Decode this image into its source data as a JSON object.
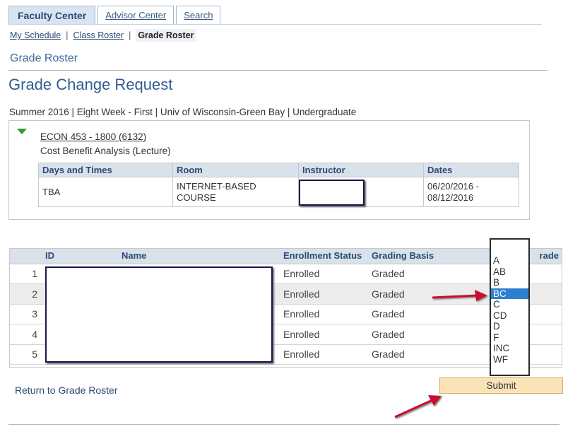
{
  "tabs": [
    {
      "label": "Faculty Center",
      "active": true
    },
    {
      "label": "Advisor Center",
      "active": false
    },
    {
      "label": "Search",
      "active": false
    }
  ],
  "subnav": {
    "my_schedule": "My Schedule",
    "class_roster": "Class Roster",
    "grade_roster": "Grade Roster",
    "separator": "|"
  },
  "section_title": "Grade Roster",
  "page_title": "Grade Change Request",
  "term_line": "Summer 2016 | Eight Week - First | Univ of Wisconsin-Green Bay | Undergraduate",
  "course": {
    "link": "ECON 453 - 1800 (6132)",
    "description": "Cost Benefit Analysis (Lecture)"
  },
  "meeting_table": {
    "headers": [
      "Days and Times",
      "Room",
      "Instructor",
      "Dates"
    ],
    "row": {
      "days": "TBA",
      "room_line1": "INTERNET-BASED",
      "room_line2": "COURSE",
      "instructor": "",
      "dates_line1": "06/20/2016 -",
      "dates_line2": "08/12/2016"
    }
  },
  "roster": {
    "headers": [
      "",
      "ID",
      "Name",
      "Enrollment Status",
      "Grading Basis",
      "rade"
    ],
    "rows": [
      {
        "num": "1",
        "status": "Enrolled",
        "basis": "Graded"
      },
      {
        "num": "2",
        "status": "Enrolled",
        "basis": "Graded"
      },
      {
        "num": "3",
        "status": "Enrolled",
        "basis": "Graded"
      },
      {
        "num": "4",
        "status": "Enrolled",
        "basis": "Graded"
      },
      {
        "num": "5",
        "status": "Enrolled",
        "basis": "Graded"
      }
    ]
  },
  "grade_options": [
    "A",
    "AB",
    "B",
    "BC",
    "C",
    "CD",
    "D",
    "F",
    "INC",
    "WF"
  ],
  "selected_grade": "BC",
  "return_link": "Return to Grade Roster",
  "submit_label": "Submit",
  "colors": {
    "active_tab_bg": "#d8e4f1",
    "title_blue": "#2f5e93",
    "header_bg": "#d9e1ea",
    "selected_option": "#2e7fd1",
    "submit_bg": "#fbe3b8",
    "arrow_red": "#c8102e",
    "redaction_border": "#17174f"
  }
}
